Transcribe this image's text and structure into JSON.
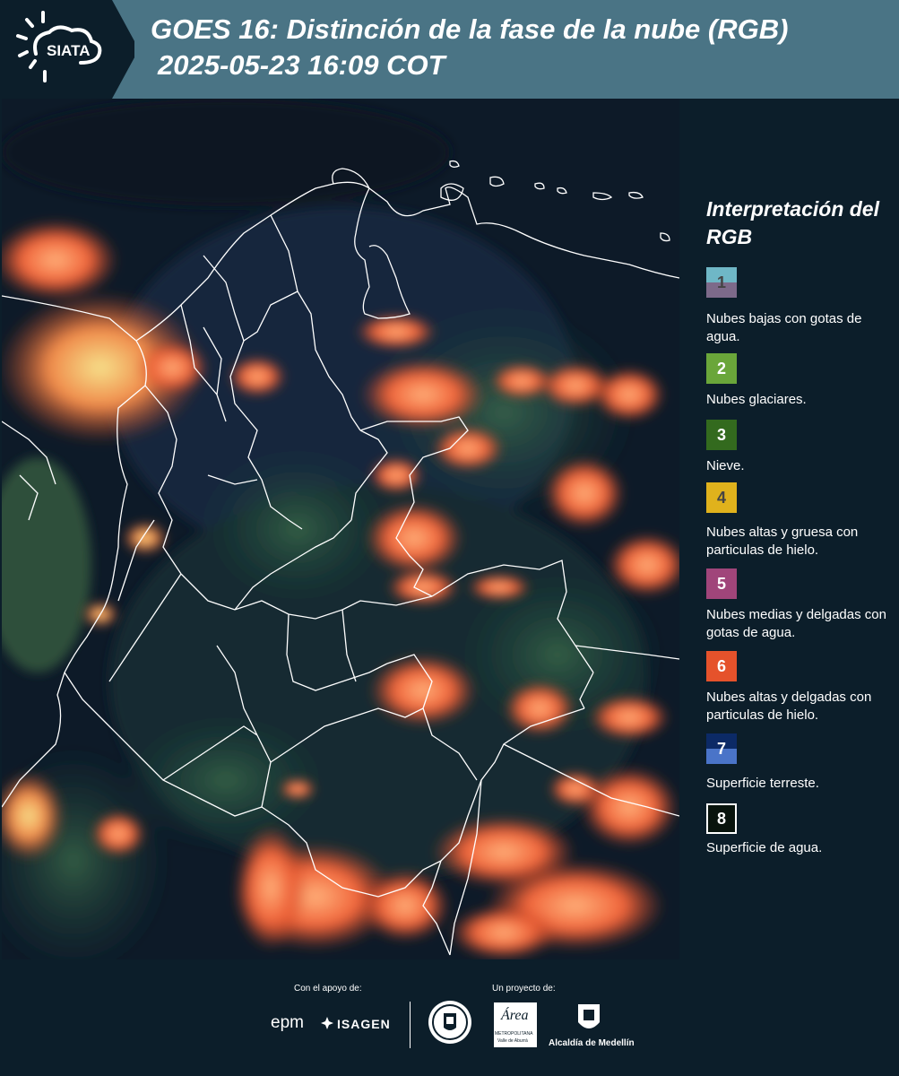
{
  "header": {
    "logo_text": "SIATA",
    "title_line1": "GOES 16: Distinción de la fase de la nube (RGB)",
    "title_line2": "2025-05-23 16:09 COT",
    "logo_icon": "sun-cloud-icon"
  },
  "legend": {
    "title": "Interpretación del RGB",
    "items": [
      {
        "num": "1",
        "label": "Nubes bajas con gotas de agua.",
        "color_top": "#6fb7c6",
        "color_bottom": "#7d6a8a"
      },
      {
        "num": "2",
        "label": "Nubes glaciares.",
        "color_top": "#6aa63a",
        "color_bottom": "#6aa63a"
      },
      {
        "num": "3",
        "label": "Nieve.",
        "color_top": "#336a1e",
        "color_bottom": "#336a1e"
      },
      {
        "num": "4",
        "label": "Nubes altas y gruesa con particulas de hielo.",
        "color_top": "#e0b21c",
        "color_bottom": "#e0b21c"
      },
      {
        "num": "5",
        "label": "Nubes medias y delgadas con gotas de agua.",
        "color_top": "#a0457a",
        "color_bottom": "#a0457a"
      },
      {
        "num": "6",
        "label": "Nubes altas y delgadas con particulas de hielo.",
        "color_top": "#e5522b",
        "color_bottom": "#e5522b"
      },
      {
        "num": "7",
        "label": "Superficie terreste.",
        "color_top": "#0c2a66",
        "color_bottom": "#4a74c8"
      },
      {
        "num": "8",
        "label": "Superficie de agua.",
        "color_top": "#08130c",
        "color_bottom": "#08130c"
      }
    ]
  },
  "footer": {
    "support_label": "Con el apoyo de:",
    "project_label": "Un proyecto de:",
    "logo_epm": "epm",
    "logo_isagen": "ISAGEN",
    "logo_area": "Área",
    "logo_area_sub1": "METROPOLITANA",
    "logo_area_sub2": "Valle de Aburrá",
    "logo_alcaldia": "Alcaldía de Medellín"
  },
  "colors": {
    "header_bg": "#4a7485",
    "panel_bg": "#0c1e2a",
    "cloud_orange": "#f0643a"
  }
}
